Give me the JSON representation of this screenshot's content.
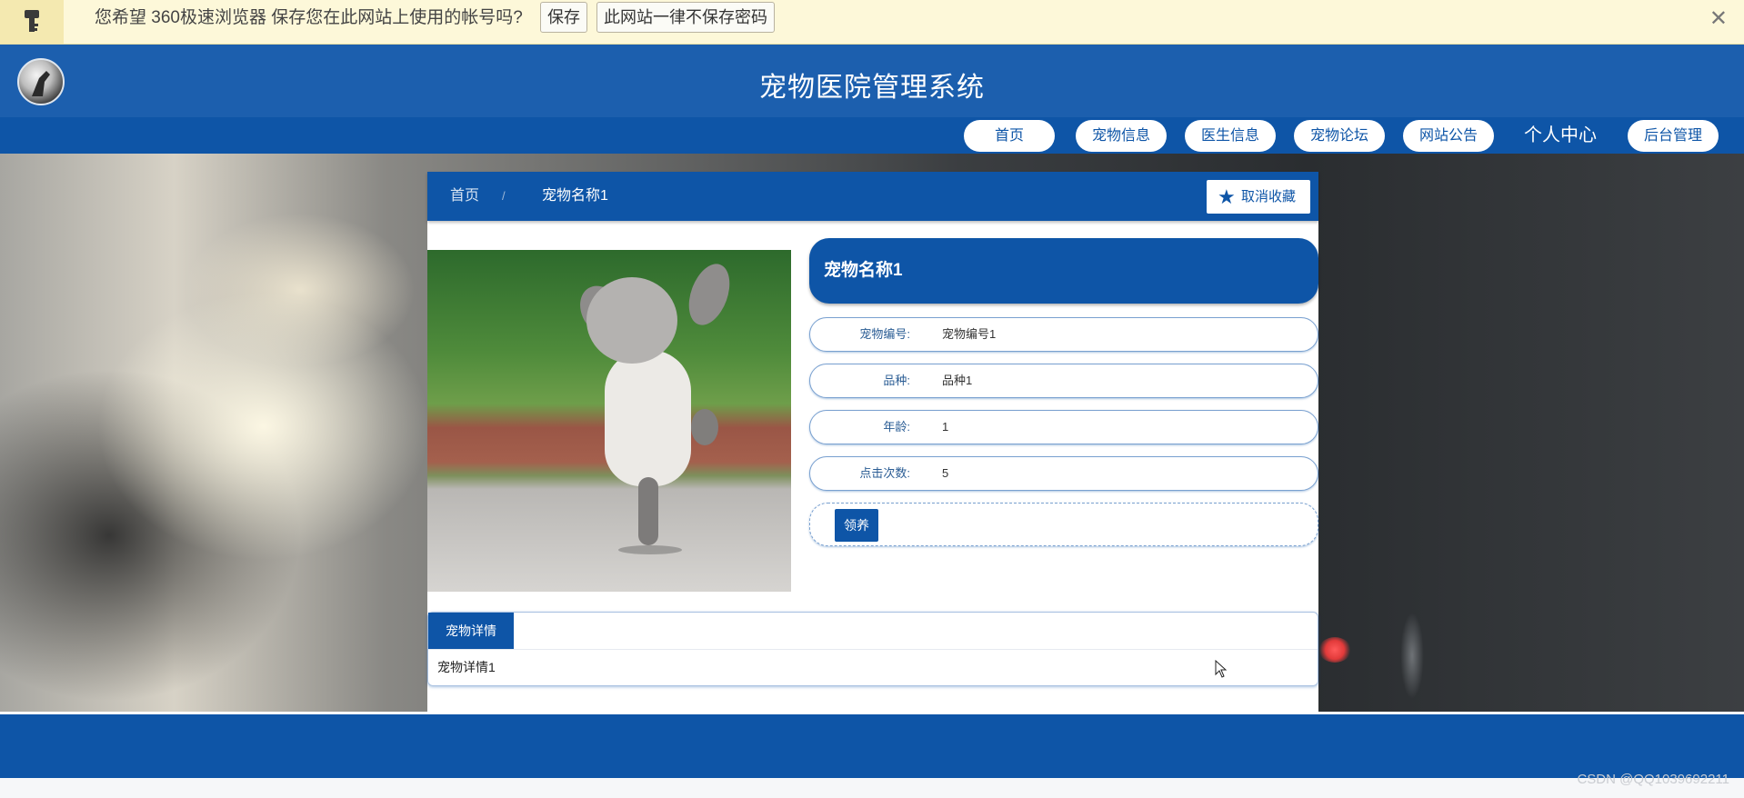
{
  "password_bar": {
    "message": "您希望 360极速浏览器 保存您在此网站上使用的帐号吗?",
    "save_label": "保存",
    "never_label": "此网站一律不保存密码",
    "close_label": "✕"
  },
  "header": {
    "title": "宠物医院管理系统"
  },
  "nav": {
    "items": [
      "首页",
      "宠物信息",
      "医生信息",
      "宠物论坛",
      "网站公告",
      "个人中心",
      "后台管理"
    ]
  },
  "breadcrumb": {
    "home": "首页",
    "separator": "/",
    "current": "宠物名称1"
  },
  "favorite_button": {
    "label": "取消收藏",
    "icon": "star-icon"
  },
  "pet": {
    "name": "宠物名称1",
    "fields": [
      {
        "label": "宠物编号:",
        "value": "宠物编号1"
      },
      {
        "label": "品种:",
        "value": "品种1"
      },
      {
        "label": "年龄:",
        "value": "1"
      },
      {
        "label": "点击次数:",
        "value": "5"
      }
    ],
    "adopt_label": "领养"
  },
  "details_tab": {
    "tab_label": "宠物详情",
    "content": "宠物详情1"
  },
  "watermark": "CSDN @QQ1039692211",
  "colors": {
    "primary": "#0e55a7",
    "header": "#1c5fae",
    "password_bar": "#fdf8d9"
  }
}
